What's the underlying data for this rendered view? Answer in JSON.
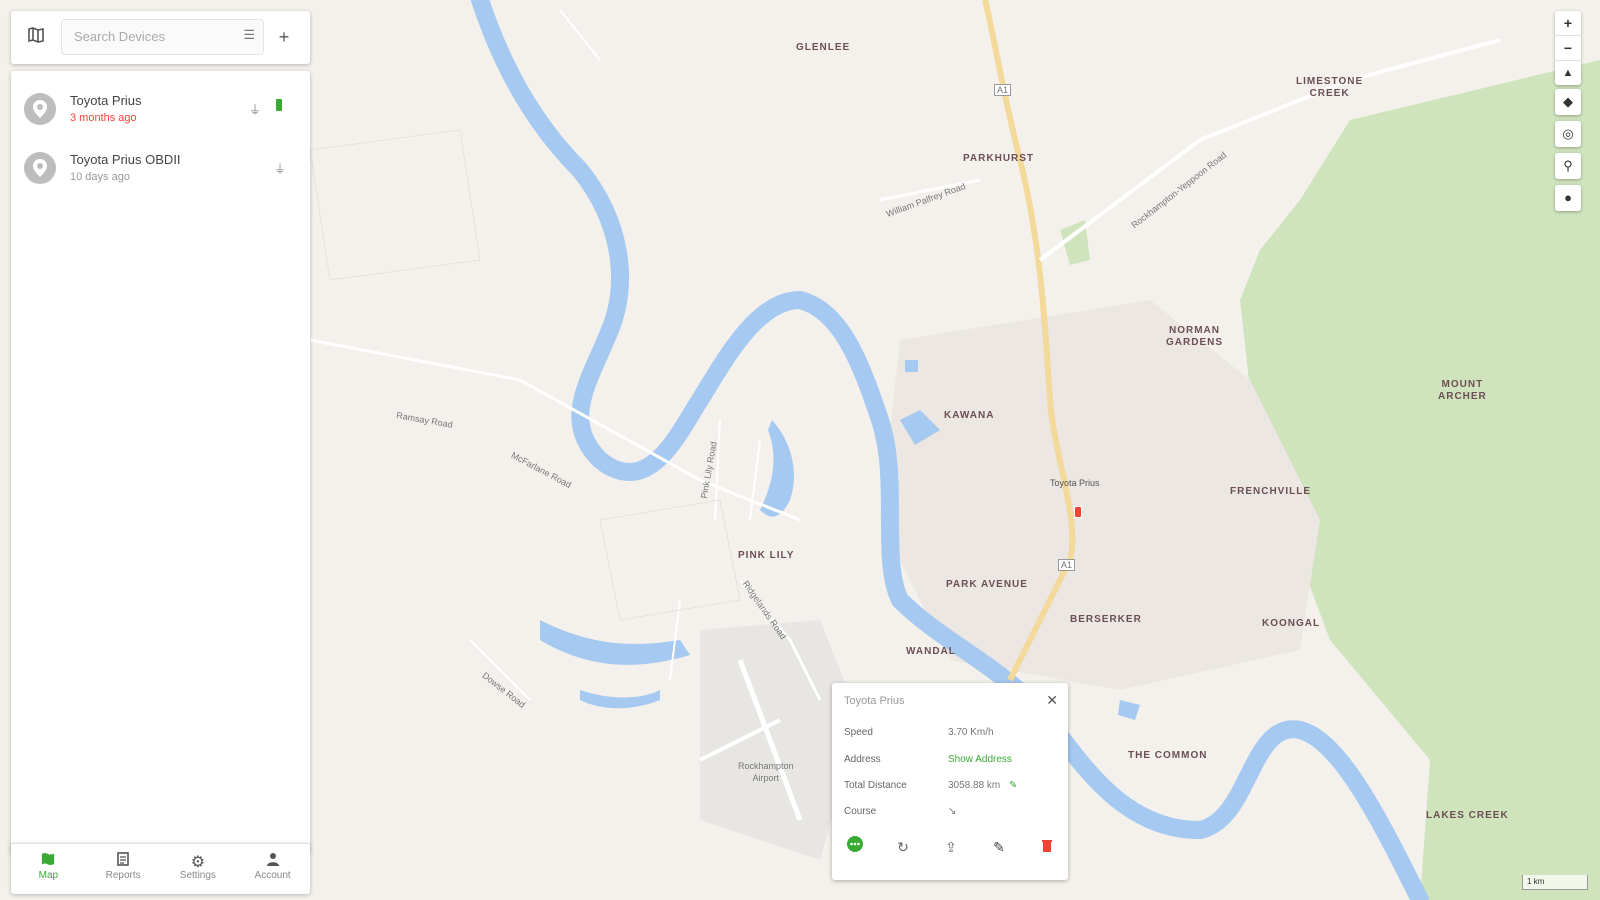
{
  "toolbar": {
    "search_placeholder": "Search Devices",
    "map_icon": "map-icon",
    "filter_icon": "filter-icon",
    "add_icon": "add-icon"
  },
  "devices": [
    {
      "name": "Toyota Prius",
      "status": "3 months ago",
      "status_color": "#f44336"
    },
    {
      "name": "Toyota Prius OBDII",
      "status": "10 days ago",
      "status_color": "#999999"
    }
  ],
  "nav": [
    {
      "label": "Map",
      "icon": "map-icon",
      "active": true
    },
    {
      "label": "Reports",
      "icon": "report-icon",
      "active": false
    },
    {
      "label": "Settings",
      "icon": "gear-icon",
      "active": false
    },
    {
      "label": "Account",
      "icon": "person-icon",
      "active": false
    }
  ],
  "map": {
    "labels": {
      "glenlee": "GLENLEE",
      "parkhurst": "PARKHURST",
      "limestone_creek": "LIMESTONE\nCREEK",
      "norman_gardens": "NORMAN\nGARDENS",
      "mount_archer": "MOUNT\nARCHER",
      "kawana": "KAWANA",
      "frenchville": "FRENCHVILLE",
      "pink_lily": "PINK LILY",
      "park_avenue": "PARK AVENUE",
      "berserker": "BERSERKER",
      "koongal": "KOONGAL",
      "wandal": "WANDAL",
      "the_common": "THE COMMON",
      "lakes_creek": "LAKES CREEK",
      "rockhampton_airport": "Rockhampton\nAirport",
      "device_marker": "Toyota Prius"
    },
    "roads": {
      "a1_north": "A1",
      "a1_south": "A1",
      "william_palfrey": "William Palfrey Road",
      "rockhampton_yeppoon": "Rockhampton-Yeppoon Road",
      "ramsay": "Ramsay Road",
      "mcfarlane": "McFarlane Road",
      "ridgelands": "Ridgelands Road",
      "pink_lily_rd": "Pink Lily Road",
      "dowse": "Dowse Road"
    },
    "scale": "1 km"
  },
  "popup": {
    "title": "Toyota Prius",
    "rows": [
      {
        "label": "Speed",
        "value": "3.70 Km/h"
      },
      {
        "label": "Address",
        "value": "Show Address"
      },
      {
        "label": "Total Distance",
        "value": "3058.88 km"
      },
      {
        "label": "Course",
        "value": "↘"
      }
    ]
  },
  "colors": {
    "accent": "#3aaa35",
    "water": "#a5c9f0",
    "park": "#cfe4bd",
    "danger": "#f44336"
  }
}
